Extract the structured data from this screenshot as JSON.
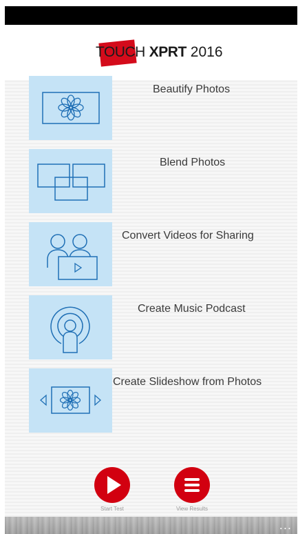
{
  "header": {
    "logo_touch": "TOUCH",
    "logo_xprt": "XPRT",
    "logo_year": "2016"
  },
  "scenarios": [
    {
      "label": "Beautify Photos",
      "icon": "flower-photo-icon"
    },
    {
      "label": "Blend Photos",
      "icon": "overlapping-frames-icon"
    },
    {
      "label": "Convert Videos for Sharing",
      "icon": "people-video-icon"
    },
    {
      "label": "Create Music Podcast",
      "icon": "podcast-icon"
    },
    {
      "label": "Create Slideshow from Photos",
      "icon": "slideshow-icon"
    }
  ],
  "actions": {
    "start_label": "Start Test",
    "start_icon": "play-icon",
    "results_label": "View Results",
    "results_icon": "menu-lines-icon"
  },
  "app_bar": {
    "more_label": "..."
  },
  "colors": {
    "tile_bg": "#c5e3f6",
    "tile_stroke": "#1f6fb5",
    "accent_red": "#d20010"
  }
}
